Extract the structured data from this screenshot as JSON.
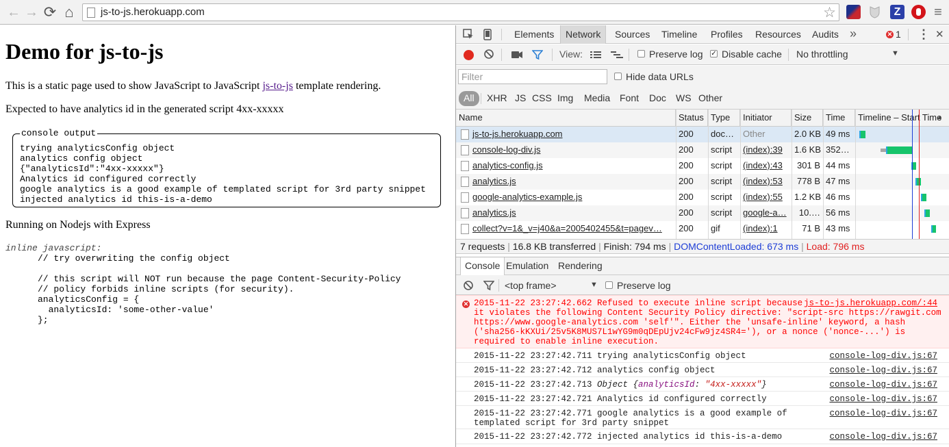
{
  "browser": {
    "url": "js-to-js.herokuapp.com",
    "back_glyph": "←",
    "forward_glyph": "→",
    "reload_glyph": "⟳",
    "home_glyph": "⌂",
    "star_glyph": "☆",
    "z_ext_label": "Z"
  },
  "page": {
    "title": "Demo for js-to-js",
    "intro_before": "This is a static page used to show JavaScript to JavaScript ",
    "intro_link": "js-to-js",
    "intro_after": " template rendering.",
    "expected": "Expected to have analytics id in the generated script 4xx-xxxxx",
    "console_legend": "console output",
    "console_lines": [
      "trying analyticsConfig object",
      "analytics config object",
      "{\"analyticsId\":\"4xx-xxxxx\"}",
      "Analytics id configured correctly",
      "google analytics is a good example of templated script for 3rd party snippet",
      "injected analytics id this-is-a-demo"
    ],
    "running": "Running on Nodejs with Express",
    "inline_label": "inline javascript:",
    "inline_code": "// try overwriting the config object\n\n// this script will NOT run because the page Content-Security-Policy\n// policy forbids inline scripts (for security).\nanalyticsConfig = {\n  analyticsId: 'some-other-value'\n};"
  },
  "devtools": {
    "tabs": [
      "Elements",
      "Network",
      "Sources",
      "Timeline",
      "Profiles",
      "Resources",
      "Audits"
    ],
    "active_tab": "Network",
    "more_glyph": "»",
    "error_count": "1",
    "menu_glyph": "⋮",
    "close_glyph": "✕",
    "network_toolbar": {
      "view_label": "View:",
      "preserve_log": "Preserve log",
      "disable_cache": "Disable cache",
      "disable_cache_checked": true,
      "throttling": "No throttling",
      "throttling_arrow": "▼"
    },
    "filter": {
      "placeholder": "Filter",
      "hide_data_urls": "Hide data URLs",
      "types": [
        "All",
        "XHR",
        "JS",
        "CSS",
        "Img",
        "Media",
        "Font",
        "Doc",
        "WS",
        "Other"
      ],
      "active_type": "All"
    },
    "table": {
      "columns": [
        "Name",
        "Status",
        "Type",
        "Initiator",
        "Size",
        "Time",
        "Timeline – Start Time"
      ],
      "sort_glyph": "▲",
      "rows": [
        {
          "name": "js-to-js.herokuapp.com",
          "status": "200",
          "type": "doc…",
          "initiator": "Other",
          "initiator_link": false,
          "size": "2.0 KB",
          "time": "49 ms",
          "wf": [
            0.01,
            0.07,
            0.0
          ]
        },
        {
          "name": "console-log-div.js",
          "status": "200",
          "type": "script",
          "initiator": "(index):39",
          "initiator_link": true,
          "size": "1.6 KB",
          "time": "352…",
          "wf": [
            0.25,
            0.3,
            0.06
          ]
        },
        {
          "name": "analytics-config.js",
          "status": "200",
          "type": "script",
          "initiator": "(index):43",
          "initiator_link": true,
          "size": "301 B",
          "time": "44 ms",
          "wf": [
            0.6,
            0.06,
            0.0
          ]
        },
        {
          "name": "analytics.js",
          "status": "200",
          "type": "script",
          "initiator": "(index):53",
          "initiator_link": true,
          "size": "778 B",
          "time": "47 ms",
          "wf": [
            0.65,
            0.06,
            0.0
          ]
        },
        {
          "name": "google-analytics-example.js",
          "status": "200",
          "type": "script",
          "initiator": "(index):55",
          "initiator_link": true,
          "size": "1.2 KB",
          "time": "46 ms",
          "wf": [
            0.71,
            0.06,
            0.0
          ]
        },
        {
          "name": "analytics.js",
          "status": "200",
          "type": "script",
          "initiator": "google-a…",
          "initiator_link": true,
          "size": "10.…",
          "time": "56 ms",
          "wf": [
            0.75,
            0.06,
            0.0
          ]
        },
        {
          "name": "collect?v=1&_v=j40&a=2005402455&t=pagev…",
          "status": "200",
          "type": "gif",
          "initiator": "(index):1",
          "initiator_link": true,
          "size": "71 B",
          "time": "43 ms",
          "wf": [
            0.83,
            0.05,
            0.0
          ]
        }
      ]
    },
    "summary": {
      "requests": "7 requests",
      "transferred": "16.8 KB transferred",
      "finish": "Finish: 794 ms",
      "dom": "DOMContentLoaded: 673 ms",
      "load": "Load: 796 ms"
    },
    "drawer_tabs": [
      "Console",
      "Emulation",
      "Rendering"
    ],
    "console_toolbar": {
      "frame": "<top frame>",
      "frame_arrow": "▼",
      "preserve_log": "Preserve log"
    },
    "console_messages": [
      {
        "level": "error",
        "text": "2015-11-22 23:27:42.662 Refused to execute inline script because\nit violates the following Content Security Policy directive: \"script-src https://rawgit.com\nhttps://www.google-analytics.com 'self'\". Either the 'unsafe-inline' keyword, a hash\n('sha256-kKXUi/25v5K8MUS7L1wYG9m0qDEpUjv24cFw9jz4SR4='), or a nonce ('nonce-...') is\nrequired to enable inline execution.",
        "source": "js-to-js.herokuapp.com/:44"
      },
      {
        "level": "log",
        "text": "2015-11-22 23:27:42.711 trying analyticsConfig object",
        "source": "console-log-div.js:67"
      },
      {
        "level": "log",
        "text": "2015-11-22 23:27:42.712 analytics config object",
        "source": "console-log-div.js:67"
      },
      {
        "level": "object",
        "prefix": "2015-11-22 23:27:42.713 ",
        "obj_label": "Object {",
        "obj_key": "analyticsId",
        "obj_sep": ": ",
        "obj_val": "\"4xx-xxxxx\"",
        "obj_end": "}",
        "source": "console-log-div.js:67"
      },
      {
        "level": "log",
        "text": "2015-11-22 23:27:42.721 Analytics id configured correctly",
        "source": "console-log-div.js:67"
      },
      {
        "level": "log",
        "text": "2015-11-22 23:27:42.771 google analytics is a good example of\ntemplated script for 3rd party snippet",
        "source": "console-log-div.js:67"
      },
      {
        "level": "log",
        "text": "2015-11-22 23:27:42.772 injected analytics id this-is-a-demo",
        "source": "console-log-div.js:67"
      }
    ],
    "colors": {
      "record": "#e12a1f",
      "waterfall_wait": "#a6a6a6",
      "waterfall_download": "#17c46b",
      "waterfall_send": "#2aa7e0",
      "dom_line": "#1d3dd6",
      "load_line": "#e02020",
      "error_text": "#ff0000"
    }
  }
}
